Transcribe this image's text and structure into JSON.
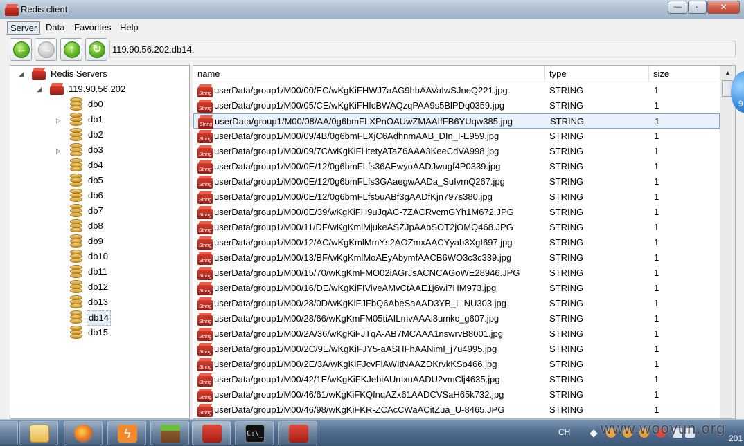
{
  "window": {
    "title": "Redis client"
  },
  "controls": {
    "minimize": "—",
    "maximize": "▫",
    "close": "✕"
  },
  "menu": {
    "server": "Server",
    "data": "Data",
    "favorites": "Favorites",
    "help": "Help"
  },
  "toolbar": {
    "back_icon": "back-arrow-icon",
    "forward_icon": "forward-arrow-icon",
    "up_icon": "up-arrow-icon",
    "refresh_icon": "refresh-icon",
    "address": "119.90.56.202:db14:"
  },
  "tree": {
    "root": "Redis Servers",
    "server": "119.90.56.202",
    "databases": [
      "db0",
      "db1",
      "db2",
      "db3",
      "db4",
      "db5",
      "db6",
      "db7",
      "db8",
      "db9",
      "db10",
      "db11",
      "db12",
      "db13",
      "db14",
      "db15"
    ],
    "expandable": [
      "db1",
      "db3"
    ],
    "selected": "db14"
  },
  "table": {
    "columns": {
      "name": "name",
      "type": "type",
      "size": "size"
    },
    "icon_label": "String",
    "selected_index": 2,
    "rows": [
      {
        "name": "userData/group1/M00/00/EC/wKgKiFHWJ7aAG9hbAAVaIwSJneQ221.jpg",
        "type": "STRING",
        "size": "1"
      },
      {
        "name": "userData/group1/M00/05/CE/wKgKiFHfcBWAQzqPAA9s5BlPDq0359.jpg",
        "type": "STRING",
        "size": "1"
      },
      {
        "name": "userData/group1/M00/08/AA/0g6bmFLXPnOAUwZMAAIfFB6YUqw385.jpg",
        "type": "STRING",
        "size": "1"
      },
      {
        "name": "userData/group1/M00/09/4B/0g6bmFLXjC6AdhnmAAB_DIn_I-E959.jpg",
        "type": "STRING",
        "size": "1"
      },
      {
        "name": "userData/group1/M00/09/7C/wKgKiFHtetyATaZ6AAA3KeeCdVA998.jpg",
        "type": "STRING",
        "size": "1"
      },
      {
        "name": "userData/group1/M00/0E/12/0g6bmFLfs36AEwyoAADJwugf4P0339.jpg",
        "type": "STRING",
        "size": "1"
      },
      {
        "name": "userData/group1/M00/0E/12/0g6bmFLfs3GAaegwAADa_SuIvmQ267.jpg",
        "type": "STRING",
        "size": "1"
      },
      {
        "name": "userData/group1/M00/0E/12/0g6bmFLfs5uABf3gAADfKjn797s380.jpg",
        "type": "STRING",
        "size": "1"
      },
      {
        "name": "userData/group1/M00/0E/39/wKgKiFH9uJqAC-7ZACRvcmGYh1M672.JPG",
        "type": "STRING",
        "size": "1"
      },
      {
        "name": "userData/group1/M00/11/DF/wKgKmlMjukeASZJpAAbSOT2jOMQ468.JPG",
        "type": "STRING",
        "size": "1"
      },
      {
        "name": "userData/group1/M00/12/AC/wKgKmlMmYs2AOZmxAACYyab3XgI697.jpg",
        "type": "STRING",
        "size": "1"
      },
      {
        "name": "userData/group1/M00/13/BF/wKgKmlMoAEyAbymfAACB6WO3c3c339.jpg",
        "type": "STRING",
        "size": "1"
      },
      {
        "name": "userData/group1/M00/15/70/wKgKmFMO02iAGrJsACNCAGoWE28946.JPG",
        "type": "STRING",
        "size": "1"
      },
      {
        "name": "userData/group1/M00/16/DE/wKgKiFIViveAMvCtAAE1j6wi7HM973.jpg",
        "type": "STRING",
        "size": "1"
      },
      {
        "name": "userData/group1/M00/28/0D/wKgKiFJFbQ6AbeSaAAD3YB_L-NU303.jpg",
        "type": "STRING",
        "size": "1"
      },
      {
        "name": "userData/group1/M00/28/66/wKgKmFM05tiAILmvAAAi8umkc_g607.jpg",
        "type": "STRING",
        "size": "1"
      },
      {
        "name": "userData/group1/M00/2A/36/wKgKiFJTqA-AB7MCAAA1nswrvB8001.jpg",
        "type": "STRING",
        "size": "1"
      },
      {
        "name": "userData/group1/M00/2C/9E/wKgKiFJY5-aASHFhAANimI_j7u4995.jpg",
        "type": "STRING",
        "size": "1"
      },
      {
        "name": "userData/group1/M00/2E/3A/wKgKiFJcvFiAWItNAAZDKrvkKSo466.jpg",
        "type": "STRING",
        "size": "1"
      },
      {
        "name": "userData/group1/M00/42/1E/wKgKiFKJebiAUmxuAADU2vmClj4635.jpg",
        "type": "STRING",
        "size": "1"
      },
      {
        "name": "userData/group1/M00/46/61/wKgKiFKQfnqAZx61AADCVSaH65k732.jpg",
        "type": "STRING",
        "size": "1"
      },
      {
        "name": "userData/group1/M00/46/98/wKgKiFKR-ZCAcCWaACitZua_U-8465.JPG",
        "type": "STRING",
        "size": "1"
      }
    ]
  },
  "taskbar": {
    "bolt_glyph": "ϟ",
    "cmd_glyph": "C:\\_",
    "input_indicator": "CH",
    "watermark": "www.wooyun.org",
    "clock_partial": "201",
    "bubble_partial": "9"
  },
  "colors": {
    "accent": "#d13a2b",
    "selection": "#e8f1fb",
    "selection_border": "#7da2ce"
  }
}
